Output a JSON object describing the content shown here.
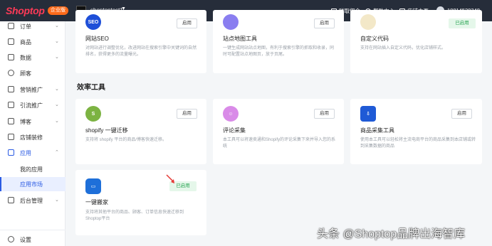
{
  "topbar": {
    "logo_text": "Shoptop",
    "badge": "企业版",
    "store_name": "shoptoptest1",
    "items": [
      {
        "label": "赚取佣金"
      },
      {
        "label": "帮助中心"
      },
      {
        "label": "店铺主页"
      },
      {
        "label": "18814529348"
      }
    ]
  },
  "sidebar": {
    "items": [
      {
        "label": "订单",
        "icon": "order-icon"
      },
      {
        "label": "商品",
        "icon": "product-icon"
      },
      {
        "label": "数据",
        "icon": "data-icon"
      },
      {
        "label": "顾客",
        "icon": "customer-icon"
      },
      {
        "label": "营销推广",
        "icon": "marketing-icon"
      },
      {
        "label": "引流推广",
        "icon": "traffic-icon"
      },
      {
        "label": "博客",
        "icon": "blog-icon"
      },
      {
        "label": "店铺装修",
        "icon": "store-decor-icon"
      },
      {
        "label": "应用",
        "icon": "apps-icon"
      },
      {
        "label": "后台管理",
        "icon": "admin-icon"
      }
    ],
    "sub_items": [
      {
        "label": "我的应用"
      },
      {
        "label": "应用市场"
      }
    ],
    "settings": "设置"
  },
  "top_cards": [
    {
      "title": "网站SEO",
      "desc": "对网站进行调整优化，改进网站在搜索引擎中关键词的自然排名，获得更多的流量曝光。",
      "button": "启用",
      "icon_text": "SEO"
    },
    {
      "title": "站点地图工具",
      "desc": "一键生成网站站点地图，有利于搜索引擎的抓取和收录，同时可配置站点地图页，放于页尾。",
      "button": "启用",
      "icon_text": ""
    },
    {
      "title": "自定义代码",
      "desc": "支持在网站插入自定义代码，优化店铺样式。",
      "status": "已启用",
      "icon_text": ""
    }
  ],
  "section_title": "效率工具",
  "tool_cards": [
    {
      "title": "shopify 一键迁移",
      "desc": "支持将 shopify 平台的商品/博客快速迁移。",
      "button": "启用"
    },
    {
      "title": "评论采集",
      "desc": "本工具可以将速卖通和Shopify的评论采集下来并导入您的系统",
      "button": "启用"
    },
    {
      "title": "商品采集工具",
      "desc": "使用本工具可以轻松将主流电商平台的商品采集到本店铺或转到采集数据的商品",
      "desc2": "或到时采集数据的一个店铺",
      "button": "启用"
    },
    {
      "title": "一键搬家",
      "desc": "支持将其他平台的商品、顾客、订单信息快速迁移到",
      "desc2": "Shoptop平台",
      "status": "已启用"
    }
  ],
  "watermark": "头条 @Shoptop品牌出海智库",
  "colors": {
    "topbar": "#262d3a",
    "accent": "#2b5be3",
    "installed_bg": "#e5f7ea",
    "installed_text": "#2ba654",
    "logo_red": "#ff3a57",
    "badge": "#ff6a1a"
  }
}
